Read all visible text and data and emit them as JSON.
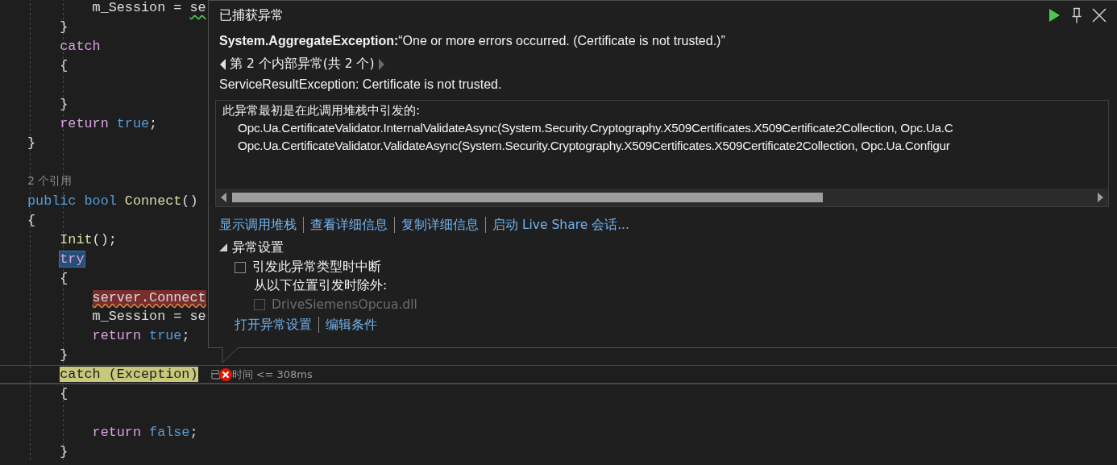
{
  "editor": {
    "lines": [
      {
        "kind": "code",
        "current": false,
        "tokens": [
          {
            "text": "        m_Session = ",
            "kind": "plain"
          },
          {
            "text": "se",
            "kind": "warning"
          }
        ]
      },
      {
        "kind": "code",
        "current": false,
        "tokens": [
          {
            "text": "    }",
            "kind": "plain"
          }
        ]
      },
      {
        "kind": "code",
        "current": false,
        "tokens": [
          {
            "text": "    catch",
            "kind": "control"
          }
        ]
      },
      {
        "kind": "code",
        "current": false,
        "tokens": [
          {
            "text": "    {",
            "kind": "plain"
          }
        ]
      },
      {
        "kind": "blank"
      },
      {
        "kind": "code",
        "current": false,
        "tokens": [
          {
            "text": "    }",
            "kind": "plain"
          }
        ]
      },
      {
        "kind": "code",
        "current": false,
        "tokens": [
          {
            "text": "    return ",
            "kind": "control"
          },
          {
            "text": "true",
            "kind": "keyword"
          },
          {
            "text": ";",
            "kind": "plain"
          }
        ]
      },
      {
        "kind": "code",
        "current": false,
        "tokens": [
          {
            "text": "}",
            "kind": "plain"
          }
        ]
      },
      {
        "kind": "blank"
      },
      {
        "kind": "codelens",
        "current": false,
        "text": "2 个引用"
      },
      {
        "kind": "code",
        "current": false,
        "tokens": [
          {
            "text": "public bool ",
            "kind": "keyword"
          },
          {
            "text": "Connect",
            "kind": "method"
          },
          {
            "text": "()",
            "kind": "plain"
          }
        ]
      },
      {
        "kind": "code",
        "current": false,
        "tokens": [
          {
            "text": "{",
            "kind": "plain"
          }
        ]
      },
      {
        "kind": "code",
        "current": false,
        "tokens": [
          {
            "text": "    Init",
            "kind": "method"
          },
          {
            "text": "();",
            "kind": "plain"
          }
        ]
      },
      {
        "kind": "code",
        "current": false,
        "tokens": [
          {
            "text": "    try",
            "kind": "selection"
          }
        ]
      },
      {
        "kind": "code",
        "current": false,
        "tokens": [
          {
            "text": "    {",
            "kind": "plain"
          }
        ]
      },
      {
        "kind": "code",
        "current": false,
        "tokens": [
          {
            "text": "        server.Connect",
            "kind": "error"
          }
        ]
      },
      {
        "kind": "code",
        "current": false,
        "tokens": [
          {
            "text": "        m_Session = se",
            "kind": "plain"
          }
        ]
      },
      {
        "kind": "code",
        "current": false,
        "tokens": [
          {
            "text": "        return ",
            "kind": "control"
          },
          {
            "text": "true",
            "kind": "keyword"
          },
          {
            "text": ";",
            "kind": "plain"
          }
        ]
      },
      {
        "kind": "code",
        "current": false,
        "tokens": [
          {
            "text": "    }",
            "kind": "plain"
          }
        ]
      },
      {
        "kind": "code",
        "current": true,
        "tokens": [
          {
            "text": "    catch (Exception)",
            "kind": "statement"
          }
        ],
        "tip": {
          "before": "已",
          "after": "时间 <= 308ms"
        }
      },
      {
        "kind": "code",
        "current": false,
        "tokens": [
          {
            "text": "    {",
            "kind": "plain"
          }
        ]
      },
      {
        "kind": "blank"
      },
      {
        "kind": "code",
        "current": false,
        "tokens": [
          {
            "text": "        return ",
            "kind": "control"
          },
          {
            "text": "false",
            "kind": "keyword"
          },
          {
            "text": ";",
            "kind": "plain"
          }
        ]
      },
      {
        "kind": "code",
        "current": false,
        "tokens": [
          {
            "text": "    }",
            "kind": "plain"
          }
        ]
      }
    ]
  },
  "popup": {
    "title": "已捕获异常",
    "exception": "**System.AggregateException:**“One or more errors occurred. (Certificate is not trusted.)”",
    "inner_nav": "第 2 个内部异常(共 2 个)",
    "inner_message": "ServiceResultException: Certificate is not trusted.",
    "stack_header": "此异常最初是在此调用堆栈中引发的:",
    "stack_frames": [
      "Opc.Ua.CertificateValidator.InternalValidateAsync(System.Security.Cryptography.X509Certificates.X509Certificate2Collection, Opc.Ua.C",
      "Opc.Ua.CertificateValidator.ValidateAsync(System.Security.Cryptography.X509Certificates.X509Certificate2Collection, Opc.Ua.Configur"
    ],
    "links": [
      "显示调用堆栈",
      "查看详细信息",
      "复制详细信息",
      "启动 Live Share 会话..."
    ],
    "settings": {
      "title": "异常设置",
      "expanded": true,
      "break_option": {
        "label": "引发此异常类型时中断",
        "checked": false
      },
      "except_label": "从以下位置引发时除外:",
      "modules": [
        {
          "label": "DriveSiemensOpcua.dll",
          "checked": false,
          "disabled": true
        }
      ],
      "links": [
        "打开异常设置",
        "编辑条件"
      ]
    }
  }
}
